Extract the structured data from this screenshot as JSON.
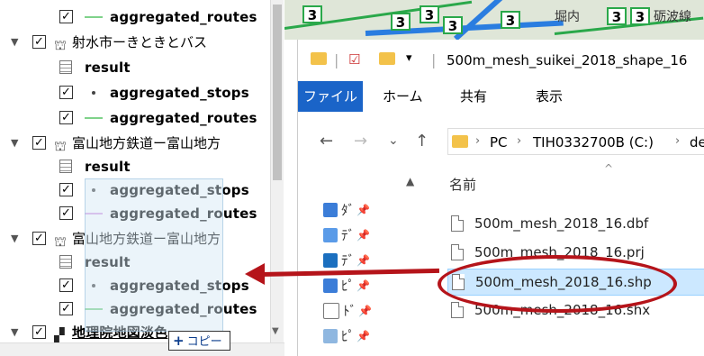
{
  "layer_tree": {
    "rows": [
      {
        "kind": "layer",
        "label": "aggregated_routes",
        "symbol": "line-green",
        "checked": "✓"
      },
      {
        "kind": "group",
        "label": "射水市ーきときとバス",
        "checked": "✓"
      },
      {
        "kind": "table",
        "label": "result"
      },
      {
        "kind": "layer",
        "label": "aggregated_stops",
        "symbol": "point",
        "checked": "✓"
      },
      {
        "kind": "layer",
        "label": "aggregated_routes",
        "symbol": "line-green",
        "checked": "✓"
      },
      {
        "kind": "group",
        "label": "富山地方鉄道ー富山地方",
        "checked": "✓"
      },
      {
        "kind": "table",
        "label": "result"
      },
      {
        "kind": "layer",
        "label": "aggregated_stops",
        "symbol": "point",
        "checked": "✓"
      },
      {
        "kind": "layer",
        "label": "aggregated_routes",
        "symbol": "line-pink",
        "checked": "✓"
      },
      {
        "kind": "group",
        "label": "富山地方鉄道ー富山地方",
        "checked": "✓"
      },
      {
        "kind": "table",
        "label": "result"
      },
      {
        "kind": "layer",
        "label": "aggregated_stops",
        "symbol": "point",
        "checked": "✓"
      },
      {
        "kind": "layer",
        "label": "aggregated_routes",
        "symbol": "line-green",
        "checked": "✓"
      },
      {
        "kind": "group",
        "label": "地理院地図淡色",
        "checked": "✓"
      }
    ],
    "copy_tooltip": {
      "plus": "+",
      "label": "コピー"
    }
  },
  "map": {
    "badges": [
      "3",
      "3",
      "3",
      "3",
      "3",
      "3",
      "3"
    ],
    "labels": [
      "堀内",
      "砺波線"
    ]
  },
  "explorer": {
    "title": "500m_mesh_suikei_2018_shape_16",
    "qa_dropdown": "▾",
    "ribbon_tabs": [
      "ファイル",
      "ホーム",
      "共有",
      "表示"
    ],
    "nav": {
      "back": "←",
      "forward": "→",
      "recent": "⌄",
      "up": "↑"
    },
    "breadcrumb": [
      "PC",
      "TIH0332700B (C:)",
      "de"
    ],
    "breadcrumb_sep": "›",
    "column_name": "名前",
    "sort_arrow": "^",
    "nav_items": [
      {
        "text": "ﾀﾞ",
        "color": "#3b7dd8",
        "pin": "📌"
      },
      {
        "text": "ﾃﾞ",
        "color": "#3b7dd8",
        "pin": "📌"
      },
      {
        "text": "ﾃﾞ",
        "color": "#1b6fbf",
        "pin": "📌"
      },
      {
        "text": "ﾋﾟ",
        "color": "#3b7dd8",
        "pin": "📌"
      },
      {
        "text": "ﾄﾞ",
        "color": "#777777",
        "pin": "📌"
      },
      {
        "text": "ﾋﾟ",
        "color": "#3b7dd8",
        "pin": "📌"
      }
    ],
    "files": [
      {
        "name": "500m_mesh_2018_16.dbf",
        "selected": false
      },
      {
        "name": "500m_mesh_2018_16.prj",
        "selected": false
      },
      {
        "name": "500m_mesh_2018_16.shp",
        "selected": true
      },
      {
        "name": "500m_mesh_2018_16.shx",
        "selected": false
      }
    ]
  },
  "colors": {
    "accent": "#1a64c8",
    "annotation": "#b5141a",
    "selection": "#cce8ff"
  }
}
